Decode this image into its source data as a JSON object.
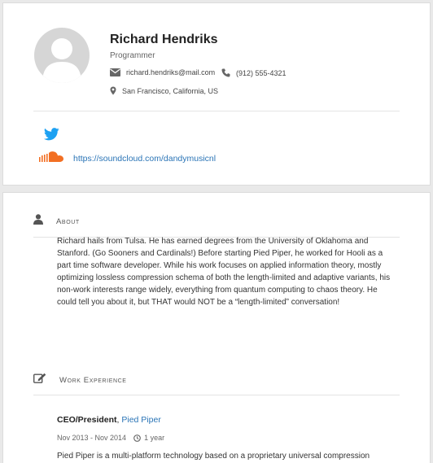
{
  "profile": {
    "name": "Richard Hendriks",
    "role": "Programmer",
    "email": "richard.hendriks@mail.com",
    "phone": "(912) 555-4321",
    "location": "San Francisco, California, US"
  },
  "social": {
    "twitter_icon": "twitter-icon",
    "soundcloud_icon": "soundcloud-icon",
    "soundcloud_url": "https://soundcloud.com/dandymusicnl"
  },
  "about": {
    "heading": "About",
    "text": "Richard hails from Tulsa. He has earned degrees from the University of Oklahoma and Stanford. (Go Sooners and Cardinals!) Before starting Pied Piper, he worked for Hooli as a part time software developer. While his work focuses on applied information theory, mostly optimizing lossless compression schema of both the length-limited and adaptive variants, his non-work interests range widely, everything from quantum computing to chaos theory. He could tell you about it, but THAT would NOT be a “length-limited” conversation!"
  },
  "work": {
    "heading": "Work Experience",
    "jobs": [
      {
        "position": "CEO/President",
        "separator": ", ",
        "company": "Pied Piper",
        "dates": "Nov 2013 - Nov 2014",
        "duration": "1 year",
        "summary": "Pied Piper is a multi-platform technology based on a proprietary universal compression"
      }
    ]
  },
  "colors": {
    "link": "#2a74b6",
    "twitter": "#1da1f2",
    "soundcloud": "#f26f23",
    "avatar_bg": "#d6d6d6"
  }
}
